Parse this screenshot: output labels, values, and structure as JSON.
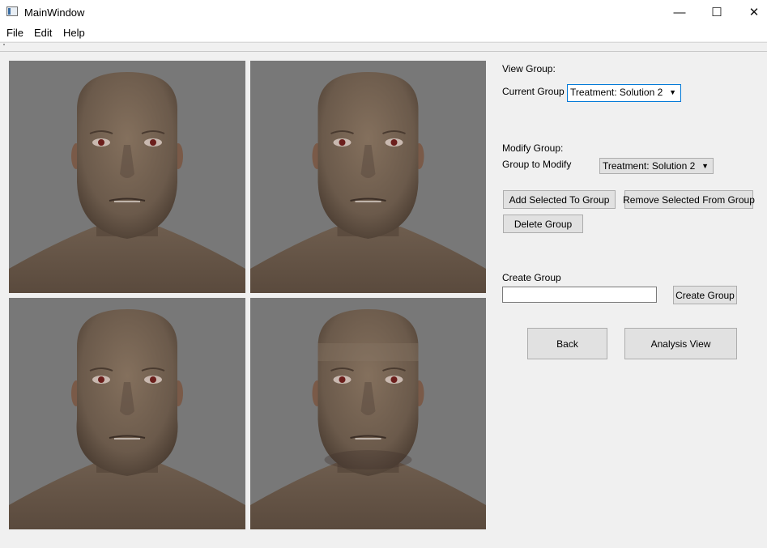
{
  "window": {
    "title": "MainWindow",
    "minimize_glyph": "—",
    "maximize_glyph": "☐",
    "close_glyph": "✕"
  },
  "menu": {
    "items": [
      "File",
      "Edit",
      "Help"
    ]
  },
  "viewports": [
    {
      "name": "face-viewport-1",
      "variant": "neutral"
    },
    {
      "name": "face-viewport-2",
      "variant": "neutral"
    },
    {
      "name": "face-viewport-3",
      "variant": "wide-jaw"
    },
    {
      "name": "face-viewport-4",
      "variant": "strong-shading"
    }
  ],
  "view_group": {
    "heading": "View Group:",
    "current_label": "Current Group",
    "current_value": "Treatment: Solution 2"
  },
  "modify_group": {
    "heading": "Modify Group:",
    "modify_label": "Group to Modify",
    "modify_value": "Treatment: Solution 2",
    "add_selected": "Add Selected To Group",
    "remove_selected": "Remove Selected From Group",
    "delete_group": "Delete Group"
  },
  "create_group": {
    "label": "Create Group",
    "input_value": "",
    "button": "Create Group"
  },
  "nav": {
    "back": "Back",
    "analysis_view": "Analysis View"
  },
  "colors": {
    "skin": "#6b5a4b",
    "viewport_bg": "#787878",
    "focus": "#0078d7"
  }
}
